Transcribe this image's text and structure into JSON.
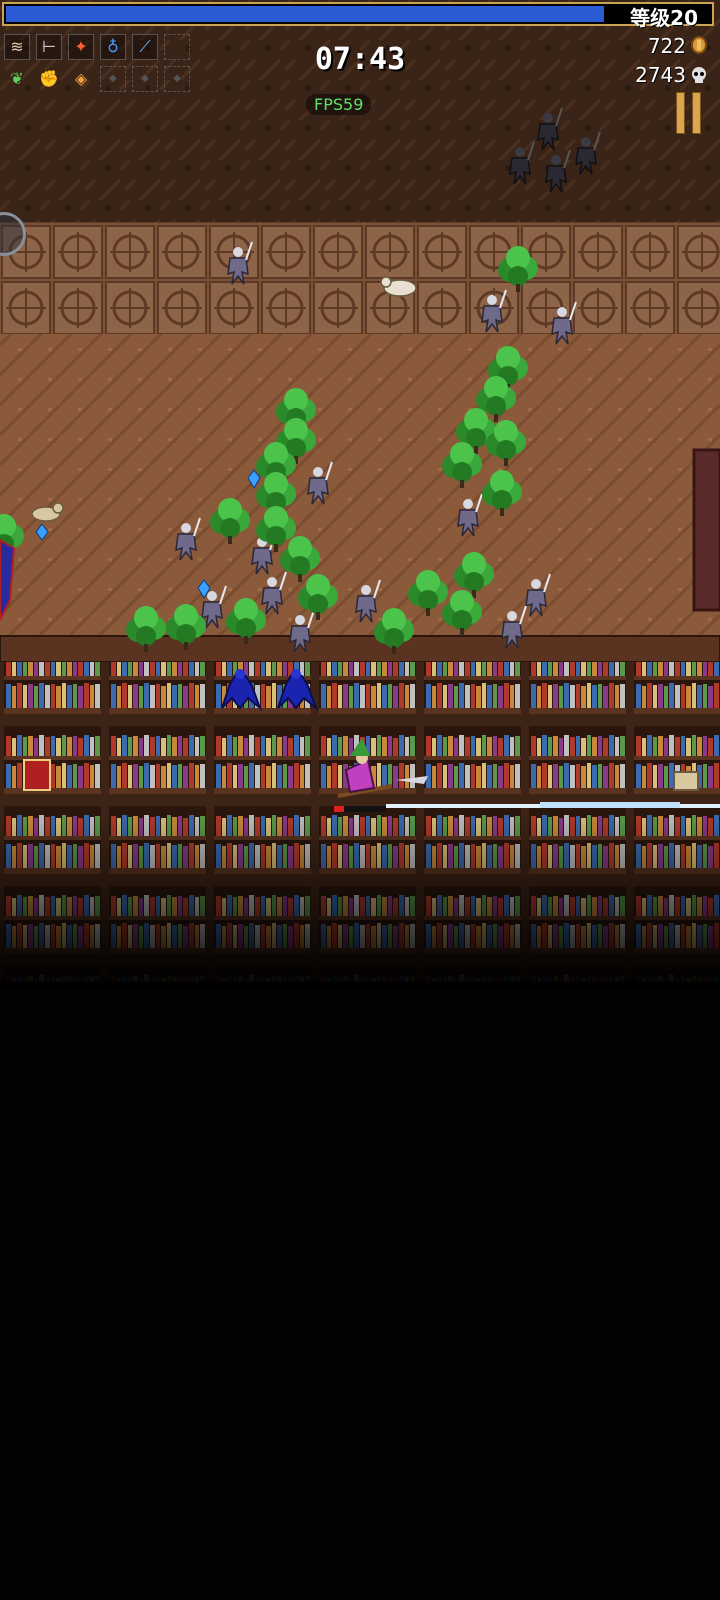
{
  "hud": {
    "level_label": "等级20",
    "xp_progress": 0.85,
    "timer": "07:43",
    "fps": "FPS59",
    "gold": "722",
    "kills": "2743",
    "weapon_slots": [
      {
        "icon": "whip-icon"
      },
      {
        "icon": "knife-icon"
      },
      {
        "icon": "fire-wand-icon"
      },
      {
        "icon": "holy-water-icon"
      },
      {
        "icon": "magic-wand-icon"
      },
      {
        "icon": "empty-slot"
      }
    ],
    "passive_slots": [
      {
        "icon": "leaf-icon"
      },
      {
        "icon": "gauntlet-icon"
      },
      {
        "icon": "candle-icon"
      },
      {
        "icon": "empty-slot"
      },
      {
        "icon": "empty-slot"
      },
      {
        "icon": "empty-slot"
      }
    ]
  },
  "colors": {
    "xp_bar": "#2d5bd6",
    "xp_border": "#c9a454",
    "fps_text": "#5fe06a",
    "floor": "#8a5a3a",
    "wall": "#3a2418",
    "tree": "#3aa83a",
    "skeleton": "#6f6a8a"
  }
}
